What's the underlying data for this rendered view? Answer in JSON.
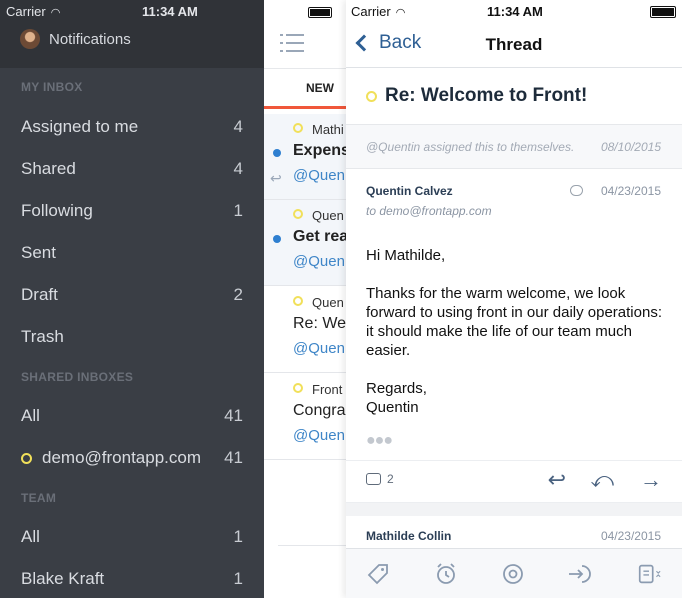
{
  "status_left": {
    "carrier": "Carrier",
    "time": "11:34 AM"
  },
  "status_right": {
    "carrier": "Carrier",
    "time": "11:34 AM"
  },
  "sidebar": {
    "notifications_label": "Notifications",
    "my_inbox_header": "MY INBOX",
    "my_inbox": [
      {
        "label": "Assigned to me",
        "count": "4"
      },
      {
        "label": "Shared",
        "count": "4"
      },
      {
        "label": "Following",
        "count": "1"
      },
      {
        "label": "Sent",
        "count": ""
      },
      {
        "label": "Draft",
        "count": "2"
      },
      {
        "label": "Trash",
        "count": ""
      }
    ],
    "shared_header": "SHARED INBOXES",
    "shared": [
      {
        "label": "All",
        "count": "41"
      },
      {
        "label": "demo@frontapp.com",
        "count": "41"
      }
    ],
    "team_header": "TEAM",
    "team": [
      {
        "label": "All",
        "count": "1"
      },
      {
        "label": "Blake Kraft",
        "count": "1"
      }
    ]
  },
  "list": {
    "tab_new": "NEW",
    "conversations": [
      {
        "from": "Mathi",
        "subject": "Expens",
        "mention": "@Quen"
      },
      {
        "from": "Quen",
        "subject": "Get rea",
        "mention": "@Quen"
      },
      {
        "from": "Quen",
        "subject": "Re: We",
        "mention": "@Quen"
      },
      {
        "from": "Front",
        "subject": "Congra",
        "mention": "@Quen"
      }
    ]
  },
  "thread": {
    "back_label": "Back",
    "title": "Thread",
    "subject": "Re: Welcome to Front!",
    "assignment_note": "@Quentin assigned this to themselves.",
    "assignment_date": "08/10/2015",
    "message": {
      "from": "Quentin Calvez",
      "to": "to demo@frontapp.com",
      "date": "04/23/2015",
      "greeting": "Hi Mathilde,",
      "body": "Thanks for the warm welcome, we look forward to using front in our daily operations: it should make the life of our team much easier.",
      "closing": "Regards,",
      "signature": "Quentin",
      "comment_count": "2"
    },
    "next_message": {
      "from": "Mathilde Collin",
      "date": "04/23/2015"
    }
  },
  "icons": {
    "reply": "↩",
    "reply_all": "⤺",
    "forward": "→"
  },
  "colors": {
    "accent": "#f0573a",
    "unread_dot": "#2e7fd0",
    "inbox_ring": "#f1e05a",
    "link": "#2e5f94"
  }
}
